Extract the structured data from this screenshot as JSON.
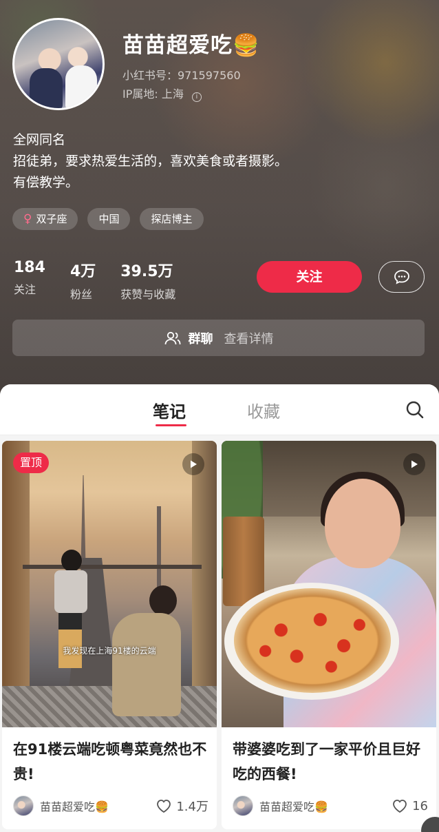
{
  "profile": {
    "name": "苗苗超爱吃🍔",
    "id_text": "小红书号：971597560",
    "ip_text": "IP属地: 上海",
    "bio_lines": [
      "全网同名",
      "招徒弟，要求热爱生活的，喜欢美食或者摄影。",
      "有偿教学。"
    ],
    "tags": [
      "双子座",
      "中国",
      "探店博主"
    ],
    "stats": [
      {
        "value": "184",
        "label": "关注"
      },
      {
        "value": "4万",
        "label": "粉丝"
      },
      {
        "value": "39.5万",
        "label": "获赞与收藏"
      }
    ],
    "follow_label": "关注",
    "group_chat": {
      "title": "群聊",
      "detail": "查看详情"
    }
  },
  "tabs": {
    "notes": "笔记",
    "collect": "收藏",
    "active": "notes"
  },
  "cards": [
    {
      "badge": "置顶",
      "caption": "我发现在上海91楼的云端",
      "title": "在91楼云端吃顿粤菜竟然也不贵!",
      "author": "苗苗超爱吃🍔",
      "likes": "1.4万"
    },
    {
      "title": "带婆婆吃到了一家平价且巨好吃的西餐!",
      "author": "苗苗超爱吃🍔",
      "likes": "16"
    }
  ],
  "colors": {
    "accent": "#ee2b48",
    "header_bg": "#5e5551",
    "female": "#ff6c8d"
  },
  "icons": [
    "info-icon",
    "female-icon",
    "message-icon",
    "group-icon",
    "search-icon",
    "play-icon",
    "heart-icon"
  ]
}
